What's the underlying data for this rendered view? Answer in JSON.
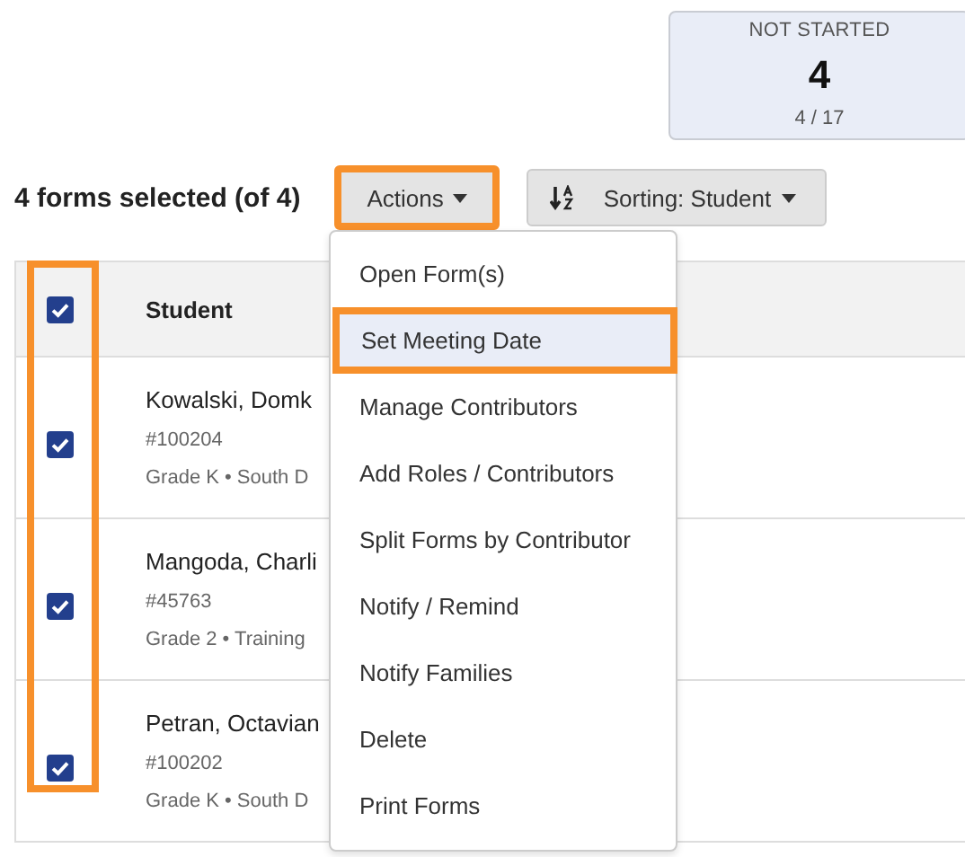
{
  "status_card": {
    "label": "NOT STARTED",
    "count": "4",
    "fraction": "4 / 17"
  },
  "selection_summary": "4 forms selected (of 4)",
  "actions_button": {
    "label": "Actions",
    "highlighted": true
  },
  "sort_button": {
    "label": "Sorting: Student"
  },
  "table": {
    "select_all": {
      "checked": true
    },
    "columns": [
      "Student"
    ],
    "checkbox_column_highlighted": true,
    "rows": [
      {
        "checked": true,
        "name": "Kowalski, Domk",
        "id": "#100204",
        "details": "Grade K • South D"
      },
      {
        "checked": true,
        "name": "Mangoda, Charli",
        "id": "#45763",
        "details": "Grade 2 • Training"
      },
      {
        "checked": true,
        "name": "Petran, Octavian",
        "id": "#100202",
        "details": "Grade K • South D"
      }
    ]
  },
  "actions_menu": {
    "items": [
      {
        "label": "Open Form(s)",
        "selected": false,
        "highlighted": false
      },
      {
        "label": "Set Meeting Date",
        "selected": true,
        "highlighted": true
      },
      {
        "label": "Manage Contributors",
        "selected": false,
        "highlighted": false
      },
      {
        "label": "Add Roles / Contributors",
        "selected": false,
        "highlighted": false
      },
      {
        "label": "Split Forms by Contributor",
        "selected": false,
        "highlighted": false
      },
      {
        "label": "Notify / Remind",
        "selected": false,
        "highlighted": false
      },
      {
        "label": "Notify Families",
        "selected": false,
        "highlighted": false
      },
      {
        "label": "Delete",
        "selected": false,
        "highlighted": false
      },
      {
        "label": "Print Forms",
        "selected": false,
        "highlighted": false
      }
    ]
  }
}
